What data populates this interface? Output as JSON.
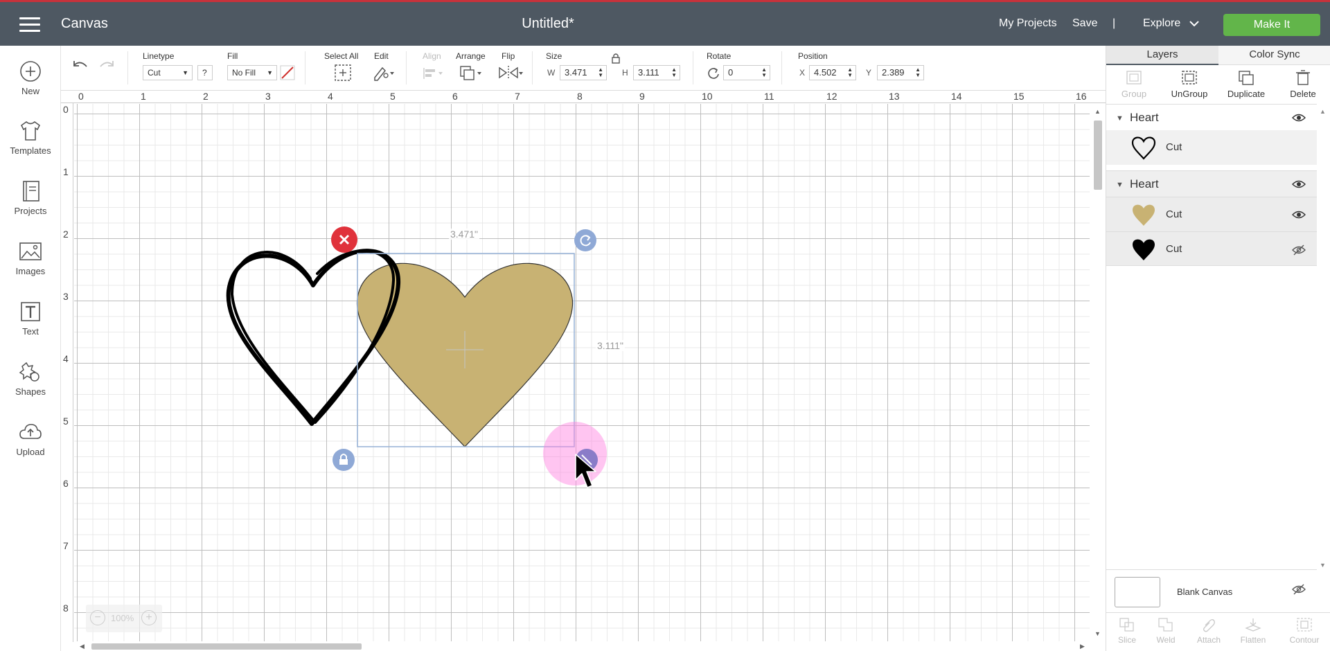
{
  "header": {
    "app_title": "Canvas",
    "document_title": "Untitled*",
    "my_projects": "My Projects",
    "save": "Save",
    "separator": "|",
    "explore": "Explore",
    "make_it": "Make It",
    "accent_color": "#62b54a",
    "bar_color": "#4e5862"
  },
  "left_nav": [
    {
      "label": "New",
      "icon": "plus-circle-icon"
    },
    {
      "label": "Templates",
      "icon": "shirt-icon"
    },
    {
      "label": "Projects",
      "icon": "notebook-icon"
    },
    {
      "label": "Images",
      "icon": "image-icon"
    },
    {
      "label": "Text",
      "icon": "text-icon"
    },
    {
      "label": "Shapes",
      "icon": "shapes-icon"
    },
    {
      "label": "Upload",
      "icon": "cloud-upload-icon"
    }
  ],
  "toolbar": {
    "linetype_label": "Linetype",
    "linetype_value": "Cut",
    "help": "?",
    "fill_label": "Fill",
    "fill_value": "No Fill",
    "select_all_label": "Select All",
    "edit_label": "Edit",
    "align_label": "Align",
    "arrange_label": "Arrange",
    "flip_label": "Flip",
    "size_label": "Size",
    "w_label": "W",
    "w_value": "3.471",
    "h_label": "H",
    "h_value": "3.111",
    "rotate_label": "Rotate",
    "rotate_value": "0",
    "position_label": "Position",
    "x_label": "X",
    "x_value": "4.502",
    "y_label": "Y",
    "y_value": "2.389"
  },
  "rulers": {
    "horizontal": [
      "0",
      "1",
      "2",
      "3",
      "4",
      "5",
      "6",
      "7",
      "8",
      "9",
      "10",
      "11",
      "12",
      "13",
      "14",
      "15",
      "16"
    ],
    "vertical": [
      "0",
      "1",
      "2",
      "3",
      "4",
      "5",
      "6",
      "7",
      "8"
    ]
  },
  "canvas": {
    "width_label": "3.471\"",
    "height_label": "3.111\"",
    "zoom_minus": "−",
    "zoom_value": "100%",
    "zoom_plus": "+",
    "gold_color": "#c8b273"
  },
  "layers_panel": {
    "tab_layers": "Layers",
    "tab_color_sync": "Color Sync",
    "actions": [
      {
        "label": "Group",
        "icon": "group-icon",
        "enabled": false
      },
      {
        "label": "UnGroup",
        "icon": "ungroup-icon",
        "enabled": true
      },
      {
        "label": "Duplicate",
        "icon": "duplicate-icon",
        "enabled": true
      },
      {
        "label": "Delete",
        "icon": "trash-icon",
        "enabled": true
      }
    ],
    "groups": [
      {
        "name": "Heart",
        "layers": [
          {
            "name": "Cut",
            "thumb": "outline-heart",
            "eye": ""
          }
        ]
      },
      {
        "name": "Heart",
        "layers": [
          {
            "name": "Cut",
            "thumb": "gold-heart",
            "eye": "visible"
          },
          {
            "name": "Cut",
            "thumb": "black-heart",
            "eye": "hidden"
          }
        ]
      }
    ],
    "blank_canvas": "Blank Canvas",
    "bottom_tools": [
      "Slice",
      "Weld",
      "Attach",
      "Flatten",
      "Contour"
    ]
  }
}
